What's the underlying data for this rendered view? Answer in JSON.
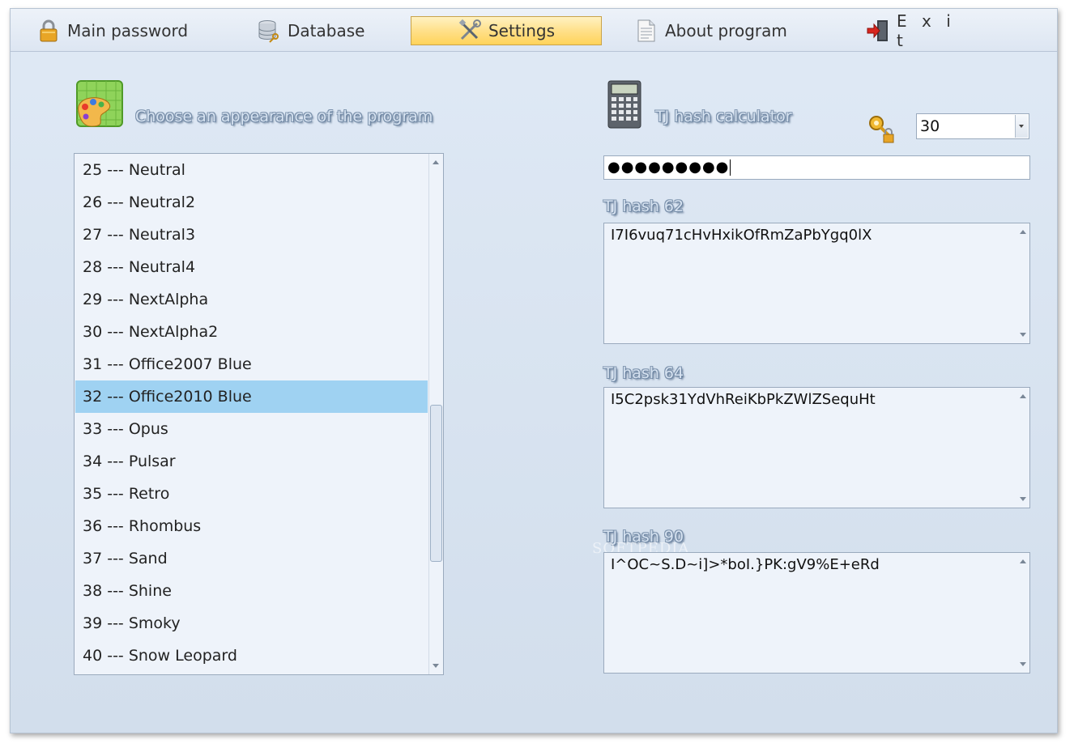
{
  "menu": {
    "items": [
      {
        "label": "Main password",
        "icon": "padlock-icon"
      },
      {
        "label": "Database",
        "icon": "database-icon"
      },
      {
        "label": "Settings",
        "icon": "tools-icon",
        "active": true
      },
      {
        "label": "About program",
        "icon": "document-icon"
      },
      {
        "label": "E x i t",
        "icon": "exit-door-icon"
      }
    ]
  },
  "appearance": {
    "title": "Choose an appearance of the program",
    "icon": "palette-icon",
    "items": [
      "25 --- Neutral",
      "26 --- Neutral2",
      "27 --- Neutral3",
      "28 --- Neutral4",
      "29 --- NextAlpha",
      "30 --- NextAlpha2",
      "31 --- Office2007 Blue",
      "32 --- Office2010 Blue",
      "33 --- Opus",
      "34 --- Pulsar",
      "35 --- Retro",
      "36 --- Rhombus",
      "37 --- Sand",
      "38 --- Shine",
      "39 --- Smoky",
      "40 --- Snow Leopard"
    ],
    "selected_index": 7
  },
  "hash": {
    "title": "TJ hash calculator",
    "icon": "calculator-icon",
    "key_icon": "key-lock-icon",
    "length_value": "30",
    "password_masked": "●●●●●●●●●",
    "hash62_label": "TJ hash 62",
    "hash62_value": "I7I6vuq71cHvHxikOfRmZaPbYgq0lX",
    "hash64_label": "TJ hash 64",
    "hash64_value": "I5C2psk31YdVhReiKbPkZWlZSequHt",
    "hash90_label": "TJ hash 90",
    "hash90_value": "I^OC~S.D~i]>*boI.}PK:gV9%E+eRd"
  },
  "watermark": "SOFTPEDIA",
  "colors": {
    "accent_active": "#ffd35a",
    "selection": "#9fd2f2",
    "window_bg": "#d6e2ef"
  }
}
